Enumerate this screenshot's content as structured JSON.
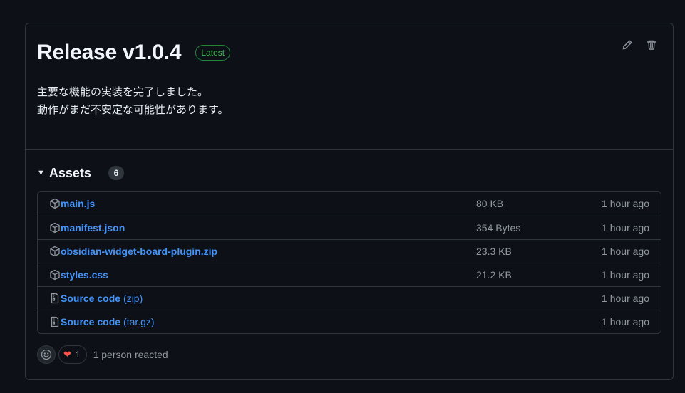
{
  "release": {
    "title": "Release v1.0.4",
    "badge": "Latest",
    "body_lines": [
      "主要な機能の実装を完了しました。",
      "動作がまだ不安定な可能性があります。"
    ]
  },
  "assets": {
    "title": "Assets",
    "count": "6",
    "rows": [
      {
        "name": "main.js",
        "suffix": "",
        "size": "80 KB",
        "time": "1 hour ago",
        "icon": "package-icon"
      },
      {
        "name": "manifest.json",
        "suffix": "",
        "size": "354 Bytes",
        "time": "1 hour ago",
        "icon": "package-icon"
      },
      {
        "name": "obsidian-widget-board-plugin.zip",
        "suffix": "",
        "size": "23.3 KB",
        "time": "1 hour ago",
        "icon": "package-icon"
      },
      {
        "name": "styles.css",
        "suffix": "",
        "size": "21.2 KB",
        "time": "1 hour ago",
        "icon": "package-icon"
      },
      {
        "name": "Source code",
        "suffix": "(zip)",
        "size": "",
        "time": "1 hour ago",
        "icon": "file-zip-icon"
      },
      {
        "name": "Source code",
        "suffix": "(tar.gz)",
        "size": "",
        "time": "1 hour ago",
        "icon": "file-zip-icon"
      }
    ]
  },
  "reactions": {
    "heart_count": "1",
    "summary": "1 person reacted"
  },
  "colors": {
    "background": "#0d1117",
    "border": "#30363d",
    "link": "#4493f8",
    "badge_green": "#3fb950",
    "muted": "#9198a1"
  }
}
